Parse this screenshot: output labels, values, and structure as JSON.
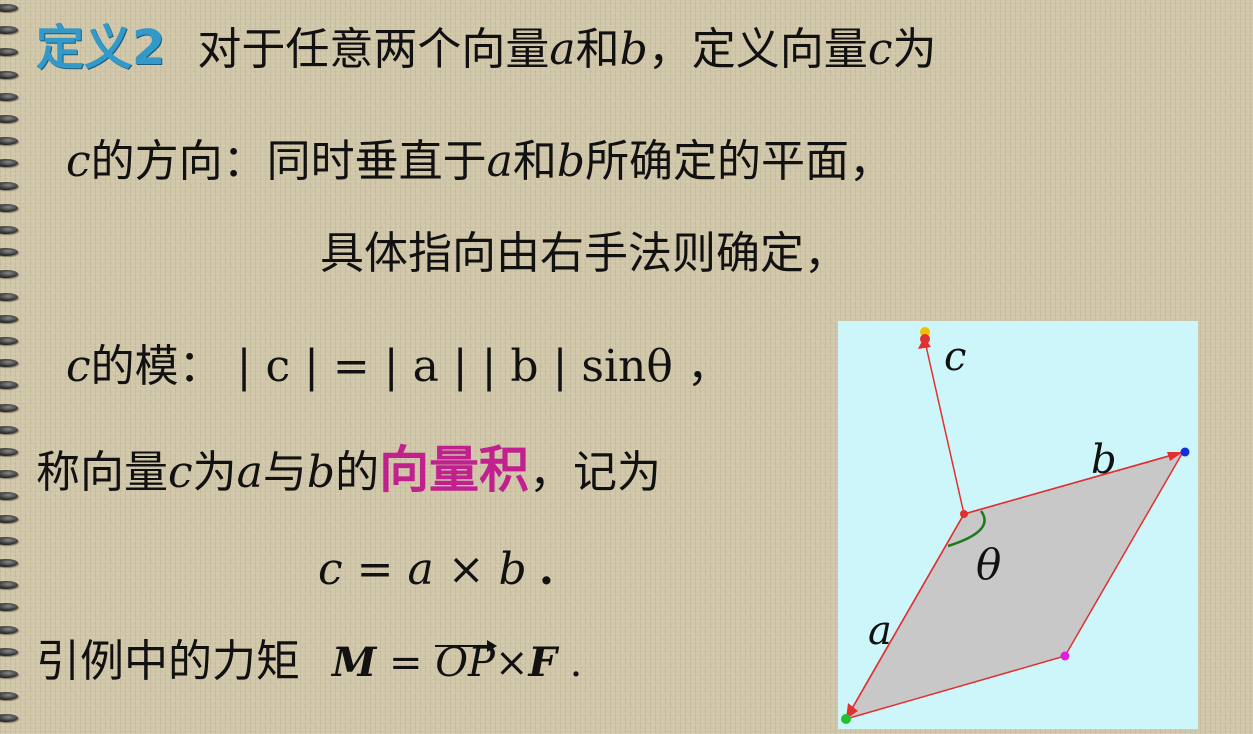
{
  "line1": {
    "title": "定义2",
    "pre": "对于任意两个向量",
    "a": "a",
    "and": "和",
    "b": "b",
    "mid": "，定义向量",
    "c": "c",
    "tail": "为"
  },
  "line2": {
    "c": "c",
    "pre": "的方向：同时垂直于",
    "a": "a",
    "and": "和",
    "b": "b",
    "tail": "所确定的平面，"
  },
  "line3": {
    "text": "具体指向由右手法则确定，"
  },
  "line4": {
    "c": "c",
    "pre": "的模：",
    "formula": "| c | = | a | | b | sinθ",
    "tail": "，"
  },
  "line5": {
    "pre": "称向量",
    "c": "c",
    "as": "为",
    "a": "a",
    "with": "与",
    "b": "b",
    "of": "的",
    "highlight": "向量积",
    "tail": "，记为"
  },
  "line6": {
    "formula": "c = a × b",
    "tail": "."
  },
  "line7": {
    "pre": "引例中的力矩",
    "M": "M",
    "eq": " = ",
    "OP": "OP",
    "times": "×",
    "F": "F",
    "tail": " ."
  },
  "diagram": {
    "label_c": "c",
    "label_b": "b",
    "label_a": "a",
    "label_theta": "θ",
    "colors": {
      "background": "#cdf6fb",
      "plane_fill": "#c8c8c8",
      "edge": "#e23030",
      "angle_arc": "#1f7a1f",
      "point_c": "#f0c000",
      "point_b": "#1030e0",
      "point_far": "#e020e0",
      "point_a": "#20c030"
    },
    "icons": [
      "c-arrowhead",
      "b-arrowhead",
      "a-arrowhead"
    ]
  },
  "accent_colors": {
    "definition_title": "#3399c9",
    "highlight": "#c0218f"
  }
}
